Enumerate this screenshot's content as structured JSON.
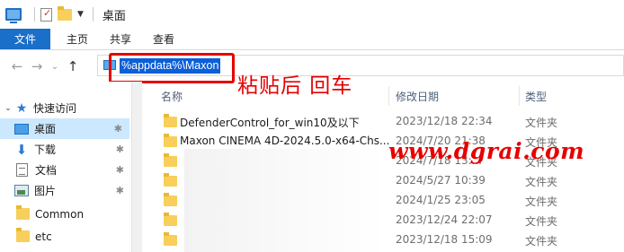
{
  "window": {
    "title": "桌面"
  },
  "ribbon": {
    "tabs": [
      "文件",
      "主页",
      "共享",
      "查看"
    ]
  },
  "address": {
    "path": "%appdata%\\Maxon"
  },
  "annotation": {
    "note": "粘贴后 回车",
    "watermark": "www.dgrai.com"
  },
  "nav": {
    "quick_access": "快速访问",
    "items": [
      {
        "label": "桌面",
        "icon": "desktop-icon",
        "pinned": true,
        "selected": true
      },
      {
        "label": "下载",
        "icon": "download-icon",
        "pinned": true
      },
      {
        "label": "文档",
        "icon": "document-icon",
        "pinned": true
      },
      {
        "label": "图片",
        "icon": "picture-icon",
        "pinned": true
      },
      {
        "label": "Common",
        "icon": "folder-icon"
      },
      {
        "label": "etc",
        "icon": "folder-icon"
      }
    ]
  },
  "columns": {
    "name": "名称",
    "modified": "修改日期",
    "type": "类型"
  },
  "files": [
    {
      "name": "DefenderControl_for_win10及以下",
      "date": "2023/12/18 22:34",
      "type": "文件夹"
    },
    {
      "name": "Maxon CINEMA 4D-2024.5.0-x64-Chs...",
      "date": "2024/7/20 21:38",
      "type": "文件夹"
    },
    {
      "name": "",
      "date": "2024/7/18 13:...",
      "type": "文件夹"
    },
    {
      "name": "",
      "date": "2024/5/27 10:39",
      "type": "文件夹"
    },
    {
      "name": "",
      "date": "2024/1/25 23:05",
      "type": "文件夹"
    },
    {
      "name": "",
      "date": "2023/12/24 22:07",
      "type": "文件夹"
    },
    {
      "name": "",
      "date": "2023/12/18 15:09",
      "type": "文件夹"
    }
  ]
}
